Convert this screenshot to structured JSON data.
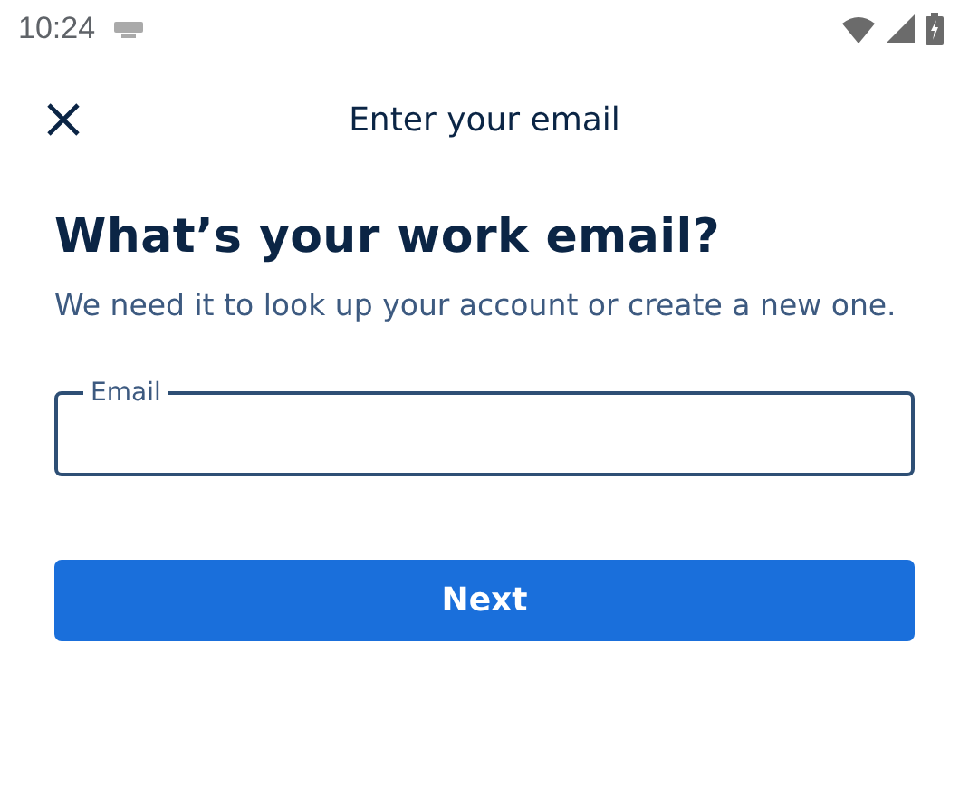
{
  "status_bar": {
    "time": "10:24"
  },
  "app_bar": {
    "title": "Enter your email"
  },
  "heading": "What’s your work email?",
  "description": "We need it to look up your account or create a new one.",
  "email_field": {
    "label": "Email"
  },
  "buttons": [
    {
      "label": "Next",
      "kind": "primary"
    }
  ]
}
